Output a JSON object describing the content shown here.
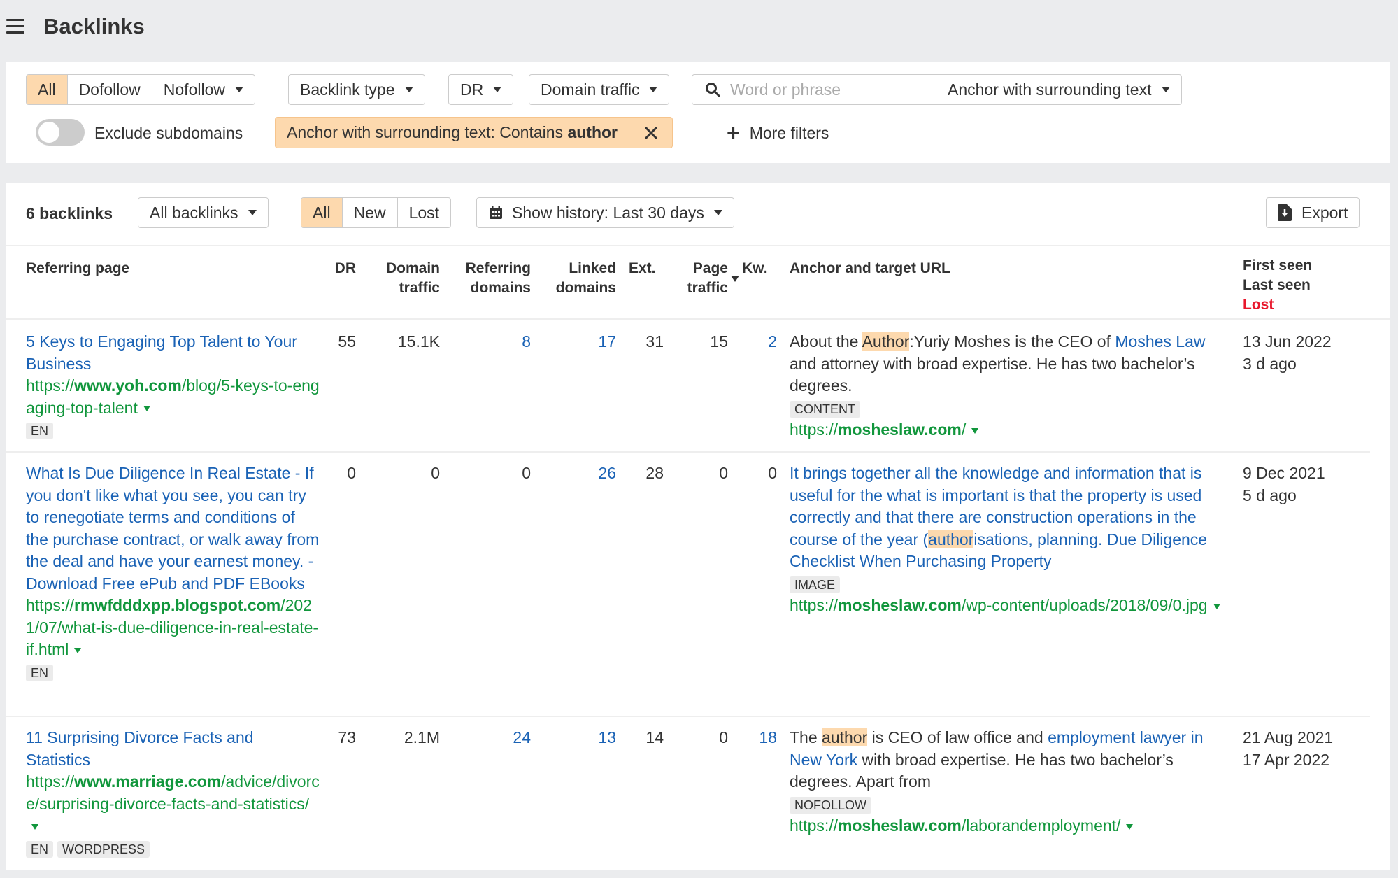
{
  "header": {
    "title": "Backlinks",
    "menu_icon": "hamburger-menu-icon"
  },
  "filters": {
    "link_type": {
      "options": [
        "All",
        "Dofollow",
        "Nofollow"
      ],
      "selected": "All"
    },
    "backlink_type": "Backlink type",
    "dr": "DR",
    "domain_traffic": "Domain traffic",
    "search": {
      "placeholder": "Word or phrase",
      "value": ""
    },
    "search_scope": "Anchor with surrounding text",
    "exclude_subdomains": {
      "label": "Exclude subdomains",
      "on": false
    },
    "active_filter": {
      "prefix": "Anchor with surrounding text: Contains ",
      "term": "author"
    },
    "more_filters": "More filters"
  },
  "toolbar": {
    "count": "6 backlinks",
    "scope": "All backlinks",
    "status": {
      "options": [
        "All",
        "New",
        "Lost"
      ],
      "selected": "All"
    },
    "history": "Show history: Last 30 days",
    "export": "Export"
  },
  "columns": {
    "referring_page": "Referring page",
    "dr": "DR",
    "domain_traffic": [
      "Domain",
      "traffic"
    ],
    "referring_domains": [
      "Referring",
      "domains"
    ],
    "linked_domains": [
      "Linked",
      "domains"
    ],
    "ext": "Ext.",
    "page_traffic": [
      "Page",
      "traffic"
    ],
    "kw": "Kw.",
    "anchor": "Anchor and target URL",
    "first_seen": "First seen",
    "last_seen": "Last seen",
    "lost": "Lost"
  },
  "rows": [
    {
      "title": "5 Keys to Engaging Top Talent to Your Business",
      "url_prefix": "https://",
      "url_domain": "www.yoh.com",
      "url_path": "/blog/5-keys-to-engaging-top-talent",
      "tags": [
        "EN"
      ],
      "dr": "55",
      "domain_traffic": "15.1K",
      "referring_domains": "8",
      "linked_domains": "17",
      "ext": "31",
      "page_traffic": "15",
      "kw": "2",
      "anchor_parts": [
        {
          "text": "About the ",
          "style": "plain"
        },
        {
          "text": "Author",
          "style": "hl"
        },
        {
          "text": ":Yuriy Moshes is the CEO of ",
          "style": "plain"
        },
        {
          "text": "Moshes Law",
          "style": "link"
        },
        {
          "text": " and attorney with broad expertise. He has two bachelor’s degrees.",
          "style": "plain"
        }
      ],
      "anchor_tag": "CONTENT",
      "target_prefix": "https://",
      "target_domain": "mosheslaw.com",
      "target_path": "/",
      "first_seen": "13 Jun 2022",
      "last_seen": "3 d ago"
    },
    {
      "title": "What Is Due Diligence In Real Estate - If you don't like what you see, you can try to renegotiate terms and conditions of the purchase contract, or walk away from the deal and have your earnest money. - Download Free ePub and PDF EBooks",
      "url_prefix": "https://",
      "url_domain": "rmwfdddxpp.blogspot.com",
      "url_path": "/2021/07/what-is-due-diligence-in-real-estate-if.html",
      "tags": [
        "EN"
      ],
      "dr": "0",
      "domain_traffic": "0",
      "referring_domains": "0",
      "linked_domains": "26",
      "ext": "28",
      "page_traffic": "0",
      "kw": "0",
      "anchor_parts": [
        {
          "text": "It brings together all the knowledge and information that is useful for the what is important is that the property is used correctly and that there are construction operations in the course of the year (",
          "style": "link"
        },
        {
          "text": "author",
          "style": "link-hl"
        },
        {
          "text": "isations, planning. Due Diligence Checklist When Purchasing Property",
          "style": "link"
        }
      ],
      "anchor_tag": "IMAGE",
      "target_prefix": "https://",
      "target_domain": "mosheslaw.com",
      "target_path": "/wp-content/uploads/2018/09/0.jpg",
      "first_seen": "9 Dec 2021",
      "last_seen": "5 d ago"
    },
    {
      "title": "11 Surprising Divorce Facts and Statistics",
      "url_prefix": "https://",
      "url_domain": "www.marriage.com",
      "url_path": "/advice/divorce/surprising-divorce-facts-and-statistics/",
      "tags": [
        "EN",
        "WORDPRESS"
      ],
      "dr": "73",
      "domain_traffic": "2.1M",
      "referring_domains": "24",
      "linked_domains": "13",
      "ext": "14",
      "page_traffic": "0",
      "kw": "18",
      "anchor_parts": [
        {
          "text": "The ",
          "style": "plain"
        },
        {
          "text": "author",
          "style": "hl"
        },
        {
          "text": " is CEO of law office and ",
          "style": "plain"
        },
        {
          "text": "employment lawyer in New York",
          "style": "link"
        },
        {
          "text": " with broad expertise. He has two bachelor’s degrees. Apart from",
          "style": "plain"
        }
      ],
      "anchor_tag": "NOFOLLOW",
      "target_prefix": "https://",
      "target_domain": "mosheslaw.com",
      "target_path": "/laborandemployment/",
      "first_seen": "21 Aug 2021",
      "last_seen": "17 Apr 2022"
    }
  ]
}
